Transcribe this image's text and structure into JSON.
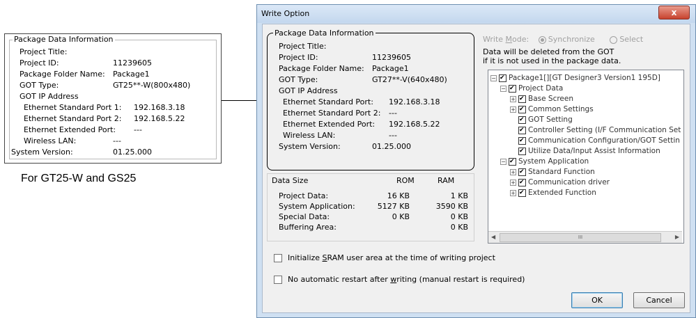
{
  "left_panel": {
    "group_title": "Package Data Information",
    "rows": [
      {
        "label": "Project Title:",
        "value": ""
      },
      {
        "label": "Project ID:",
        "value": "11239605"
      },
      {
        "label": "Package Folder Name:",
        "value": "Package1"
      },
      {
        "label": "GOT Type:",
        "value": "GT25**-W(800x480)"
      },
      {
        "label": "GOT IP Address",
        "value": ""
      },
      {
        "label": "Ethernet Standard Port 1:",
        "value": "192.168.3.18"
      },
      {
        "label": "Ethernet Standard Port 2:",
        "value": "192.168.5.22"
      },
      {
        "label": "Ethernet Extended Port:",
        "value": "---"
      },
      {
        "label": "Wireless LAN:",
        "value": "---"
      },
      {
        "label": "System Version:",
        "value": "01.25.000"
      }
    ],
    "caption": "For GT25-W and GS25"
  },
  "dialog": {
    "title": "Write Option",
    "close_label": "x",
    "package_info": {
      "group_title": "Package Data Information",
      "rows": [
        {
          "label": "Project Title:",
          "value": ""
        },
        {
          "label": "Project ID:",
          "value": "11239605"
        },
        {
          "label": "Package Folder Name:",
          "value": "Package1"
        },
        {
          "label": "GOT Type:",
          "value": "GT27**-V(640x480)"
        },
        {
          "label": "GOT IP Address",
          "value": ""
        },
        {
          "label": "Ethernet Standard Port:",
          "value": "192.168.3.18"
        },
        {
          "label": "Ethernet Standard Port 2:",
          "value": "---"
        },
        {
          "label": "Ethernet Extended Port:",
          "value": "192.168.5.22"
        },
        {
          "label": "Wireless LAN:",
          "value": "---"
        },
        {
          "label": "System Version:",
          "value": "01.25.000"
        }
      ]
    },
    "data_size": {
      "header": "Data Size",
      "col_rom": "ROM",
      "col_ram": "RAM",
      "rows": [
        {
          "label": "Project Data:",
          "rom": "16 KB",
          "ram": "1 KB"
        },
        {
          "label": "System Application:",
          "rom": "5127 KB",
          "ram": "3590 KB"
        },
        {
          "label": "Special Data:",
          "rom": "0 KB",
          "ram": "0 KB"
        },
        {
          "label": "Buffering Area:",
          "rom": "",
          "ram": "0 KB"
        }
      ]
    },
    "write_mode": {
      "label_pre": "Write ",
      "label_key": "M",
      "label_post": "ode:",
      "option_sync": "Synchronize",
      "option_select": "Select",
      "selected": "Synchronize"
    },
    "note_line1": "Data will be deleted from the GOT",
    "note_line2": "if it is not used in the package data.",
    "tree": [
      {
        "text": "Package1[][GT Designer3 Version1 195D]",
        "expander": "−",
        "checked": true
      },
      {
        "text": "Project Data",
        "expander": "−",
        "checked": true
      },
      {
        "text": "Base Screen",
        "expander": "+",
        "checked": true
      },
      {
        "text": "Common Settings",
        "expander": "+",
        "checked": true
      },
      {
        "text": "GOT Setting",
        "expander": "",
        "checked": true
      },
      {
        "text": "Controller Setting (I/F Communication Set",
        "expander": "",
        "checked": true
      },
      {
        "text": "Communication Configuration/GOT Settin",
        "expander": "",
        "checked": true
      },
      {
        "text": "Utilize Data/Input Assist Information",
        "expander": "",
        "checked": true
      },
      {
        "text": "System Application",
        "expander": "−",
        "checked": true
      },
      {
        "text": "Standard Function",
        "expander": "+",
        "checked": true
      },
      {
        "text": "Communication driver",
        "expander": "+",
        "checked": true
      },
      {
        "text": "Extended Function",
        "expander": "+",
        "checked": true
      }
    ],
    "scroll_thumb": "III",
    "options": {
      "sram_pre": "Initialize ",
      "sram_key": "S",
      "sram_post": "RAM user area at the time of writing project",
      "restart_pre": "No automatic restart after ",
      "restart_key": "w",
      "restart_post": "riting (manual restart is required)"
    },
    "ok_label": "OK",
    "cancel_label": "Cancel"
  }
}
